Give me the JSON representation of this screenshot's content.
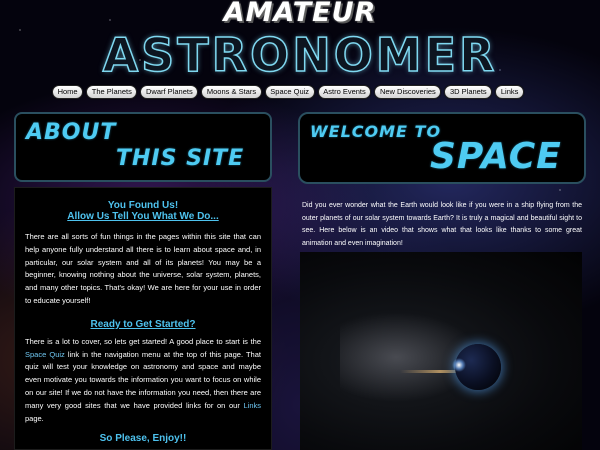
{
  "header": {
    "title_top": "AMATEUR",
    "title_main": "ASTRONOMER"
  },
  "nav": {
    "items": [
      {
        "label": "Home"
      },
      {
        "label": "The Planets"
      },
      {
        "label": "Dwarf Planets"
      },
      {
        "label": "Moons & Stars"
      },
      {
        "label": "Space Quiz"
      },
      {
        "label": "Astro Events"
      },
      {
        "label": "New Discoveries"
      },
      {
        "label": "3D Planets"
      },
      {
        "label": "Links"
      }
    ]
  },
  "about": {
    "banner_line1": "ABOUT",
    "banner_line2": "THIS SITE",
    "heading1": "You Found Us!",
    "heading2": "Allow Us Tell You What We Do...",
    "paragraph1": "There are all sorts of fun things in the pages within this site that can help anyone fully understand all there is to learn about space and, in particular, our solar system and all of its planets! You may be a beginner, knowing nothing about the universe, solar system, planets, and many other topics. That's okay! We are here for your use in order to educate yourself!",
    "heading3": "Ready to Get Started?",
    "paragraph2_a": "There is a lot to cover, so lets get started! A good place to start is the ",
    "paragraph2_link1": "Space Quiz",
    "paragraph2_b": " link in the navigation menu at the top of this page. That quiz will test your knowledge on astronomy and space and maybe even motivate you towards the information you want to focus on while on our site! If we do not have the information you need, then there are many very good sites that we have provided links for on our ",
    "paragraph2_link2": "Links",
    "paragraph2_c": " page.",
    "heading4": "So Please, Enjoy!!"
  },
  "welcome": {
    "banner_line1": "WELCOME TO",
    "banner_line2": "SPACE",
    "paragraph": "Did you ever wonder what the Earth would look like if you were in a ship flying from the outer planets of our solar system towards Earth? It is truly a magical and beautiful sight to see. Here below is an video that shows what that looks like thanks to some great animation and even imagination!"
  },
  "colors": {
    "accent": "#4ecbf2",
    "background": "#04030d",
    "text": "#ffffff"
  }
}
